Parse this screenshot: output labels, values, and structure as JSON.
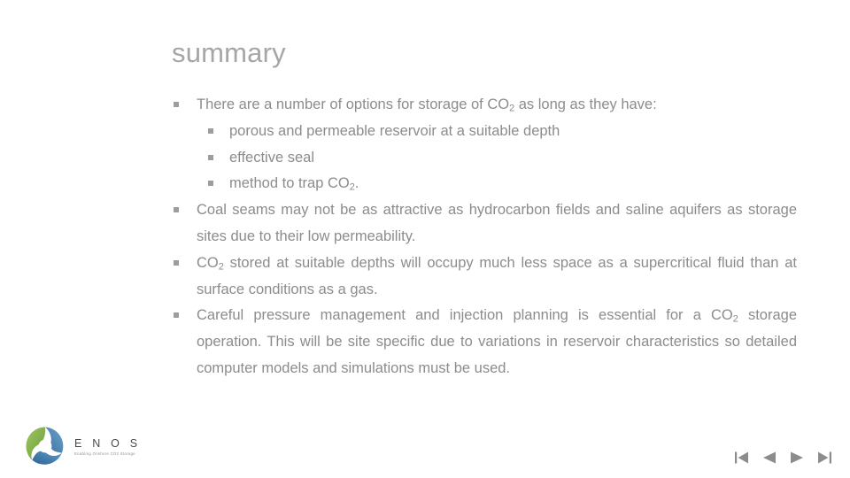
{
  "slide": {
    "title": "summary",
    "title_color": "#a6a6a6",
    "body_color": "#8c8c8c",
    "background": "#ffffff",
    "bullets": [
      {
        "level": 1,
        "marker": "square-bullet",
        "justify": false,
        "segments": [
          {
            "t": "There are a number of options for storage of CO"
          },
          {
            "t": "2",
            "sub": true
          },
          {
            "t": " as long as they have:"
          }
        ]
      },
      {
        "level": 2,
        "marker": "square-bullet",
        "justify": false,
        "segments": [
          {
            "t": "porous and permeable reservoir at a suitable depth"
          }
        ]
      },
      {
        "level": 2,
        "marker": "square-bullet",
        "justify": false,
        "segments": [
          {
            "t": "effective seal"
          }
        ]
      },
      {
        "level": 2,
        "marker": "square-bullet",
        "justify": false,
        "segments": [
          {
            "t": "method to trap CO"
          },
          {
            "t": "2",
            "sub": true
          },
          {
            "t": "."
          }
        ]
      },
      {
        "level": 1,
        "marker": "square-bullet",
        "justify": true,
        "segments": [
          {
            "t": "Coal seams may not be as attractive as hydrocarbon fields and saline aquifers as storage sites due to their low permeability."
          }
        ]
      },
      {
        "level": 1,
        "marker": "square-bullet",
        "justify": true,
        "segments": [
          {
            "t": "CO"
          },
          {
            "t": "2",
            "sub": true
          },
          {
            "t": " stored at suitable depths will occupy much less space as a supercritical fluid than at surface conditions as a gas."
          }
        ]
      },
      {
        "level": 1,
        "marker": "square-bullet",
        "justify": true,
        "segments": [
          {
            "t": "Careful pressure management and injection planning is essential for a CO"
          },
          {
            "t": "2",
            "sub": true
          },
          {
            "t": " storage operation. This will be site specific due to variations in reservoir characteristics so detailed computer models and simulations must be used."
          }
        ]
      }
    ]
  },
  "logo": {
    "name": "E N O S",
    "tagline": "Enabling Onshore CO2 Storage",
    "mark_name": "enos-swirl-logo",
    "color_green": "#7fae3f",
    "color_green_dark": "#5b8f35",
    "color_blue": "#3d7fb8",
    "color_blue_dark": "#2f6596"
  },
  "navigation": {
    "first": {
      "label": "First slide",
      "icon": "first-slide-icon"
    },
    "previous": {
      "label": "Previous slide",
      "icon": "previous-slide-icon"
    },
    "next": {
      "label": "Next slide",
      "icon": "next-slide-icon"
    },
    "last": {
      "label": "Last slide",
      "icon": "last-slide-icon"
    },
    "color": "#8c8c8c"
  }
}
